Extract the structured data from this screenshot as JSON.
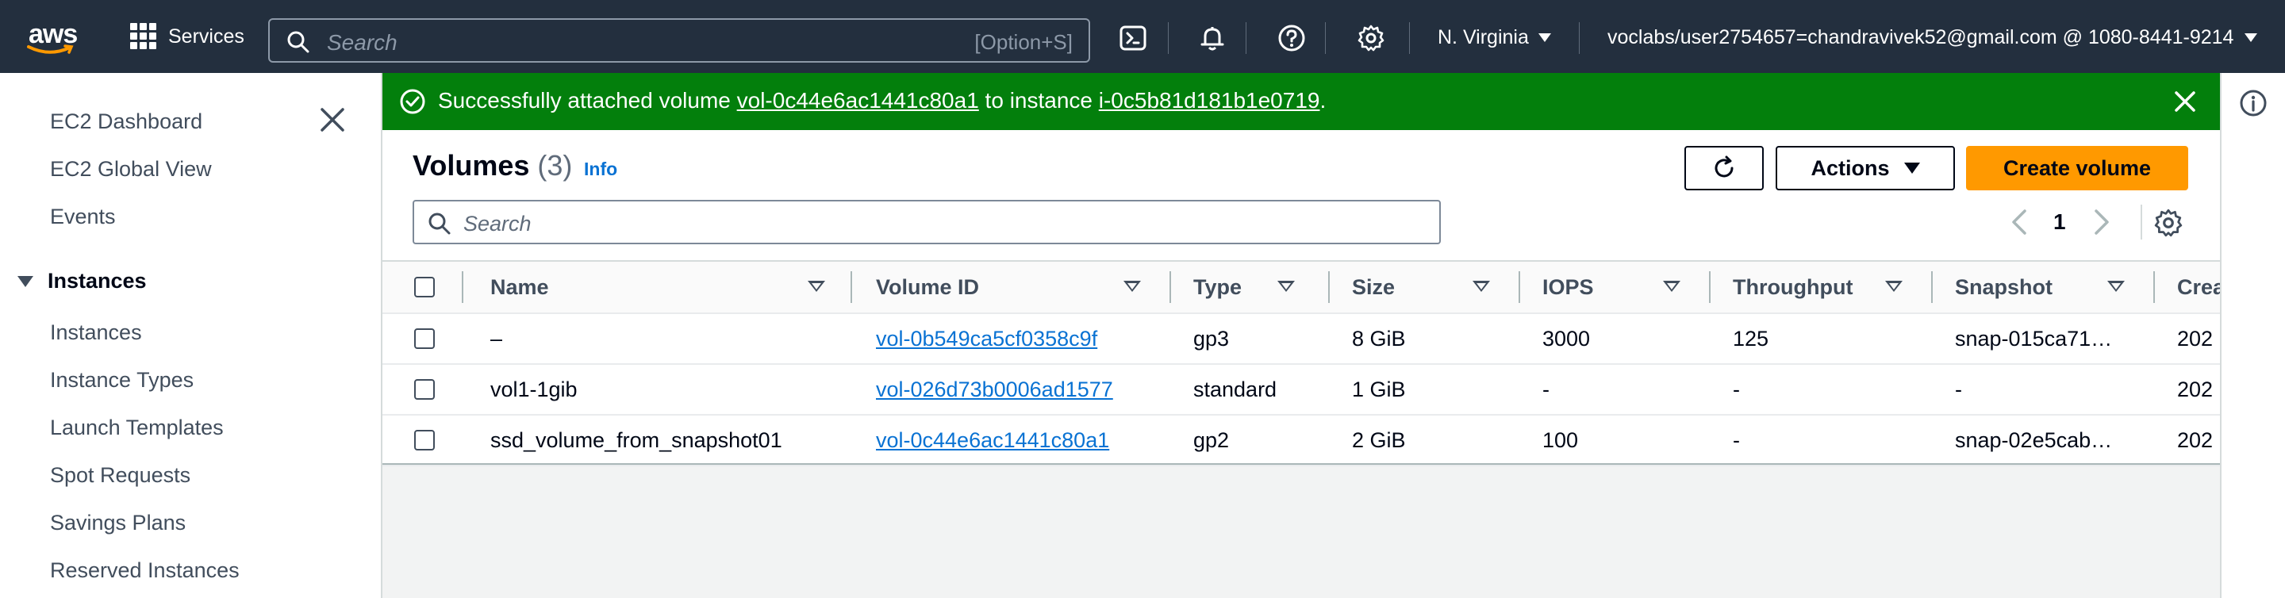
{
  "topnav": {
    "logo_text": "aws",
    "services_label": "Services",
    "search_placeholder": "Search",
    "search_shortcut": "[Option+S]",
    "icons": [
      "cloudshell-icon",
      "bell-icon",
      "help-icon",
      "gear-icon"
    ],
    "region": "N. Virginia",
    "account": "voclabs/user2754657=chandravivek52@gmail.com @ 1080-8441-9214"
  },
  "sidebar": {
    "items": [
      "EC2 Dashboard",
      "EC2 Global View",
      "Events"
    ],
    "section": "Instances",
    "section_items": [
      "Instances",
      "Instance Types",
      "Launch Templates",
      "Spot Requests",
      "Savings Plans",
      "Reserved Instances"
    ]
  },
  "flash": {
    "prefix": "Successfully attached volume ",
    "volume_link": "vol-0c44e6ac1441c80a1",
    "middle": " to instance ",
    "instance_link": "i-0c5b81d181b1e0719",
    "suffix": ".",
    "color": "#037f0c"
  },
  "volumes": {
    "title": "Volumes",
    "count": "(3)",
    "info": "Info",
    "actions_label": "Actions",
    "create_label": "Create volume",
    "search_placeholder": "Search",
    "page": "1",
    "columns": [
      "Name",
      "Volume ID",
      "Type",
      "Size",
      "IOPS",
      "Throughput",
      "Snapshot",
      "Crea"
    ],
    "rows": [
      {
        "name": "–",
        "volume_id": "vol-0b549ca5cf0358c9f",
        "type": "gp3",
        "size": "8 GiB",
        "iops": "3000",
        "throughput": "125",
        "snapshot": "snap-015ca71…",
        "created": "202"
      },
      {
        "name": "vol1-1gib",
        "volume_id": "vol-026d73b0006ad1577",
        "type": "standard",
        "size": "1 GiB",
        "iops": "-",
        "throughput": "-",
        "snapshot": "-",
        "created": "202"
      },
      {
        "name": "ssd_volume_from_snapshot01",
        "volume_id": "vol-0c44e6ac1441c80a1",
        "type": "gp2",
        "size": "2 GiB",
        "iops": "100",
        "throughput": "-",
        "snapshot": "snap-02e5cab…",
        "created": "202"
      }
    ],
    "accent_color": "#ff9900",
    "link_color": "#0972d3"
  }
}
